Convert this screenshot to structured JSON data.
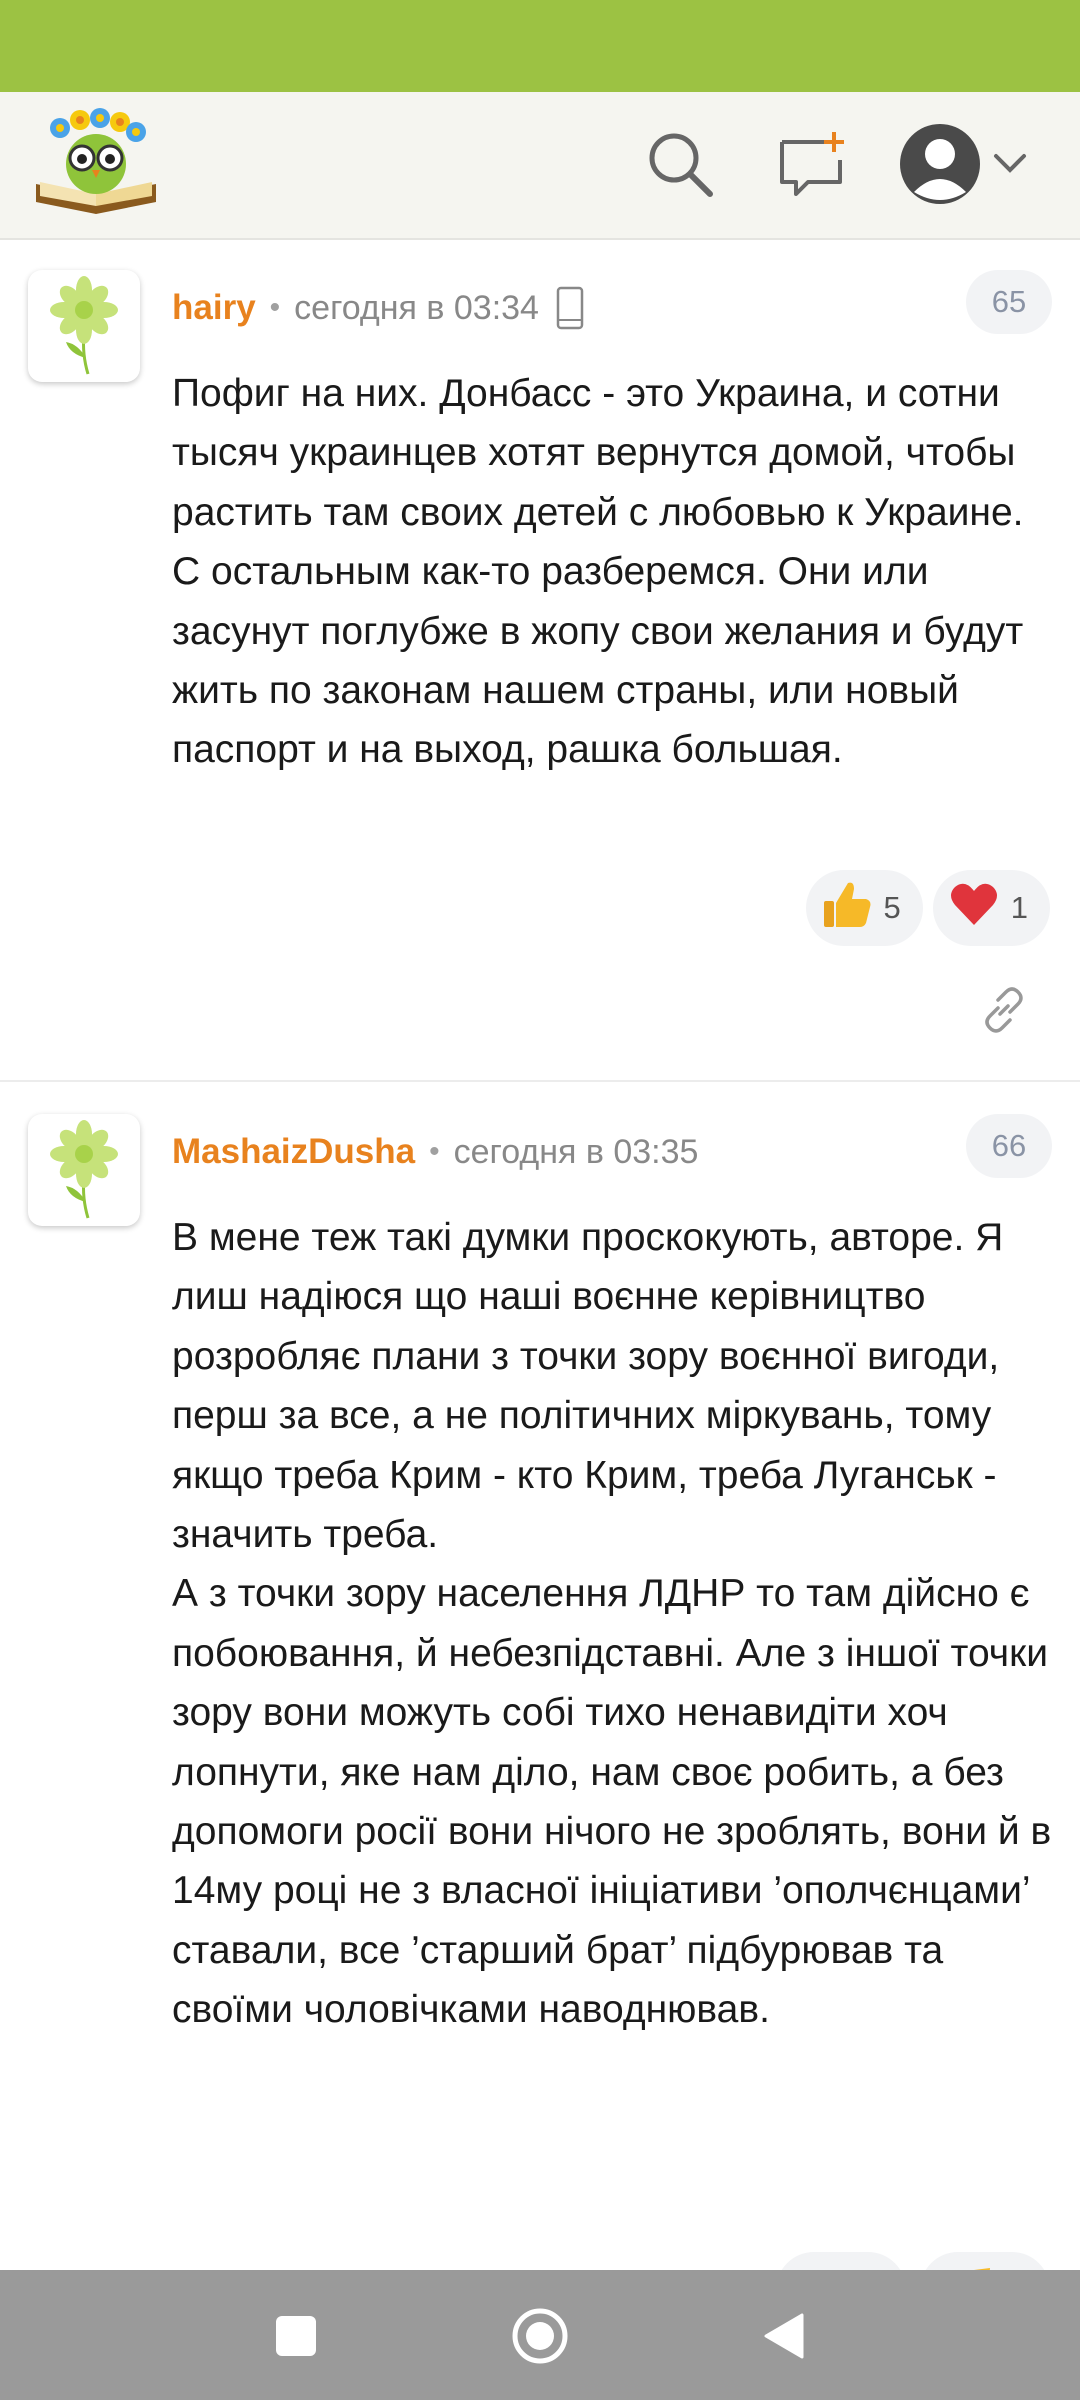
{
  "header": {
    "logo_icon": "owl-book-logo-icon",
    "search_icon": "search-icon",
    "new_topic_icon": "new-topic-icon",
    "avatar_icon": "user-avatar-icon",
    "menu_icon": "chevron-down-icon"
  },
  "comments": [
    {
      "author": "hairy",
      "time": "сегодня в 03:34",
      "device_icon": "mobile-phone-icon",
      "number": "65",
      "text": "Пофиг на них. Донбасс - это Украина, и сотни тысяч украинцев хотят вернутся домой, чтобы растить там своих детей с любовью к Украине. С остальным как-то разберемся. Они или засунут поглубже в жопу свои желания и будут жить по законам нашем страны, или новый паспорт и на выход, рашка большая.",
      "reactions": [
        {
          "icon": "thumbs-up-icon",
          "count": "5"
        },
        {
          "icon": "heart-icon",
          "count": "1"
        }
      ]
    },
    {
      "author": "MashaizDusha",
      "time": "сегодня в 03:35",
      "number": "66",
      "text": "В мене теж такі думки проскокують, авторе. Я лиш надіюся що наші воєнне керівництво розробляє плани з точки зору воєнної вигоди, перш за все, а не політичних міркувань, тому якщо треба Крим - кто Крим, треба Луганськ - значить треба.\nА з точки зору населення ЛДНР то там дійсно є побоювання, й небезпідставні. Але з іншої точки зору вони можуть собі тихо ненавидіти хоч лопнути, яке нам діло, нам своє робить, а без допомоги росії вони нічого не зроблять, вони й в 14му році не з власної ініціативи ’ополчєнцами’ ставали, все ’старший брат’ підбурював та своїми чоловічками наводнював."
    }
  ],
  "colors": {
    "status_bar": "#9cc243",
    "author": "#e8821e",
    "nav_bar": "#9a9a9a"
  },
  "nav": {
    "recent_icon": "square-icon",
    "home_icon": "circle-home-icon",
    "back_icon": "back-triangle-icon"
  }
}
